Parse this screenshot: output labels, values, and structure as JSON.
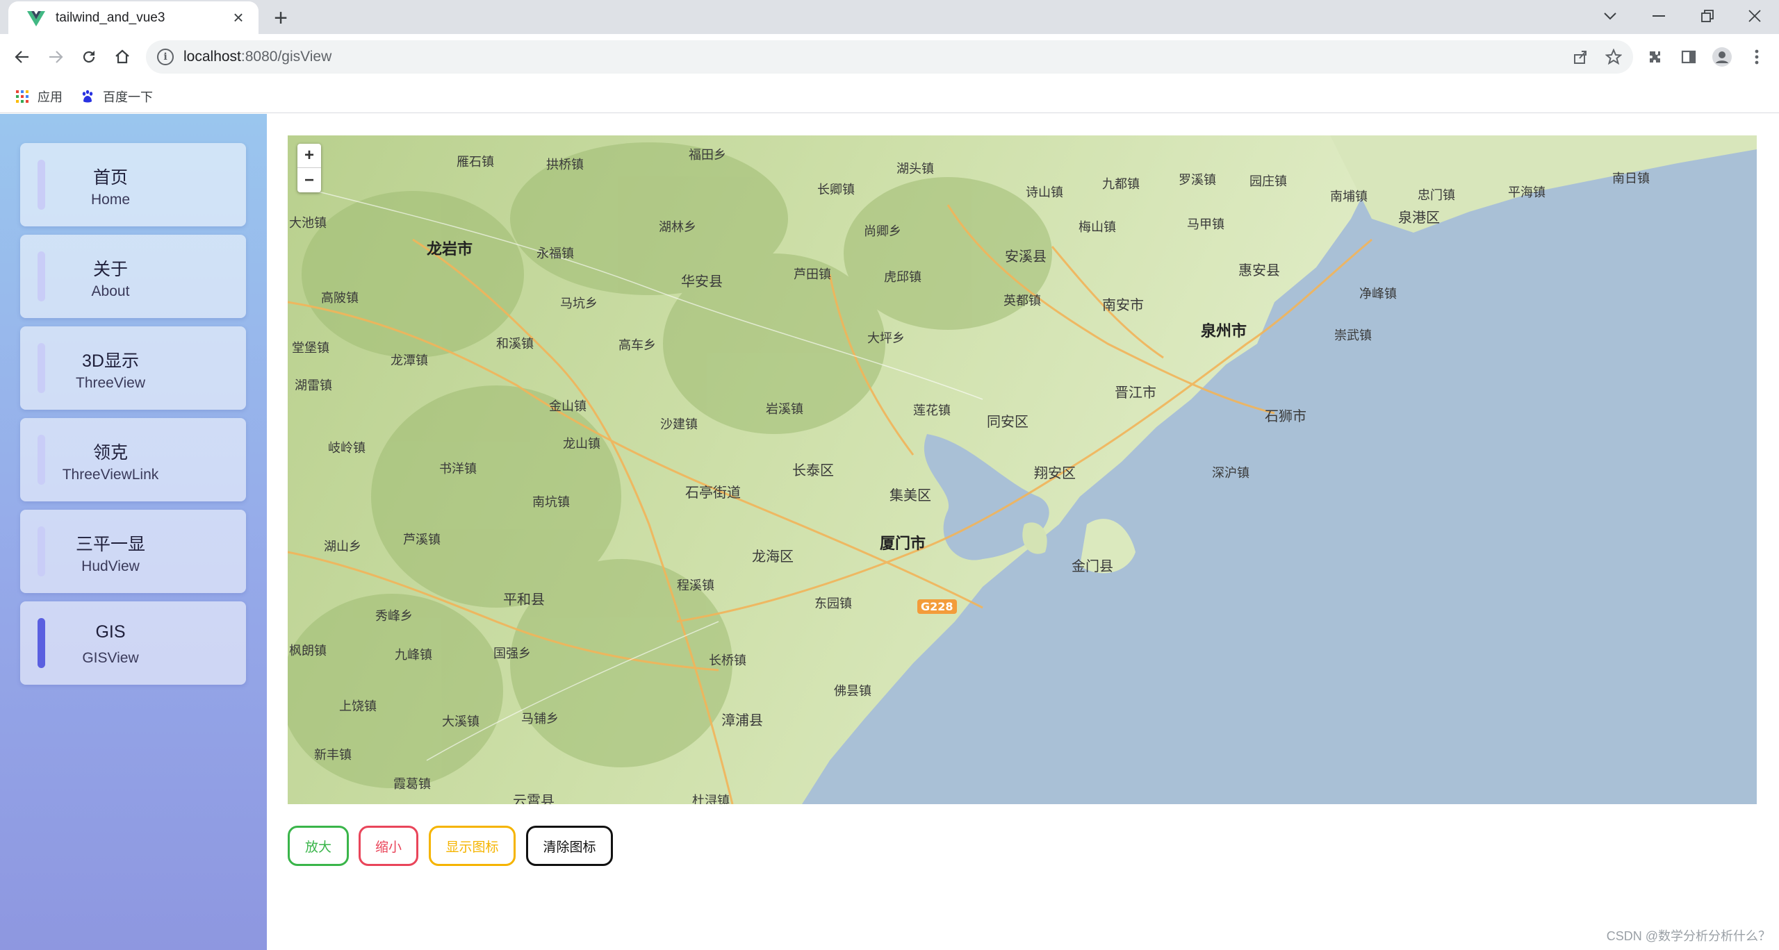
{
  "browser": {
    "tab_title": "tailwind_and_vue3",
    "url_host": "localhost",
    "url_path": ":8080/gisView",
    "bookmarks": [
      {
        "label": "应用",
        "icon": "apps-grid-icon"
      },
      {
        "label": "百度一下",
        "icon": "baidu-paw-icon"
      }
    ]
  },
  "sidebar": {
    "items": [
      {
        "cn": "首页",
        "en": "Home",
        "active": false
      },
      {
        "cn": "关于",
        "en": "About",
        "active": false
      },
      {
        "cn": "3D显示",
        "en": "ThreeView",
        "active": false
      },
      {
        "cn": "领克",
        "en": "ThreeViewLink",
        "active": false
      },
      {
        "cn": "三平一显",
        "en": "HudView",
        "active": false
      },
      {
        "cn": "GIS",
        "en": "GISView",
        "active": true
      }
    ]
  },
  "map": {
    "zoom_in": "+",
    "zoom_out": "−",
    "road_badge": "G228",
    "labels": {
      "l0": "福田乡",
      "l1": "雁石镇",
      "l2": "拱桥镇",
      "l3": "长卿镇",
      "l4": "湖头镇",
      "l5": "诗山镇",
      "l6": "九都镇",
      "l7": "罗溪镇",
      "l8": "园庄镇",
      "l9": "南埔镇",
      "l10": "忠门镇",
      "l11": "平海镇",
      "l12": "南日镇",
      "l13": "大池镇",
      "l14": "龙岩市",
      "l15": "永福镇",
      "l16": "湖林乡",
      "l17": "尚卿乡",
      "l18": "安溪县",
      "l19": "梅山镇",
      "l20": "马甲镇",
      "l21": "泉港区",
      "l22": "华安县",
      "l23": "芦田镇",
      "l24": "虎邱镇",
      "l25": "惠安县",
      "l26": "高陂镇",
      "l27": "马坑乡",
      "l28": "英都镇",
      "l29": "南安市",
      "l30": "净峰镇",
      "l31": "泉州市",
      "l32": "崇武镇",
      "l33": "堂堡镇",
      "l34": "和溪镇",
      "l35": "高车乡",
      "l36": "大坪乡",
      "l37": "龙潭镇",
      "l38": "湖雷镇",
      "l39": "晋江市",
      "l40": "金山镇",
      "l41": "岩溪镇",
      "l42": "莲花镇",
      "l43": "石狮市",
      "l44": "沙建镇",
      "l45": "同安区",
      "l46": "龙山镇",
      "l47": "岐岭镇",
      "l48": "书洋镇",
      "l49": "长泰区",
      "l50": "翔安区",
      "l51": "深沪镇",
      "l52": "石亭街道",
      "l53": "集美区",
      "l54": "南坑镇",
      "l55": "厦门市",
      "l56": "芦溪镇",
      "l57": "湖山乡",
      "l58": "龙海区",
      "l59": "金门县",
      "l60": "平和县",
      "l61": "程溪镇",
      "l62": "东园镇",
      "l63": "秀峰乡",
      "l64": "枫朗镇",
      "l65": "九峰镇",
      "l66": "国强乡",
      "l67": "长桥镇",
      "l68": "佛昙镇",
      "l69": "上饶镇",
      "l70": "大溪镇",
      "l71": "马铺乡",
      "l72": "漳浦县",
      "l73": "新丰镇",
      "l74": "霞葛镇",
      "l75": "云霄县",
      "l76": "杜浔镇"
    }
  },
  "buttons": [
    {
      "label": "放大",
      "color": "#3ab54a"
    },
    {
      "label": "缩小",
      "color": "#e9455a"
    },
    {
      "label": "显示图标",
      "color": "#f5b400"
    },
    {
      "label": "清除图标",
      "color": "#111111"
    }
  ],
  "watermark": "CSDN @数学分析分析什么？",
  "colors": {
    "sea": "#a9c0d6",
    "land": "#cfe0ae",
    "sidebar_active_bar": "#5a5fe0"
  }
}
